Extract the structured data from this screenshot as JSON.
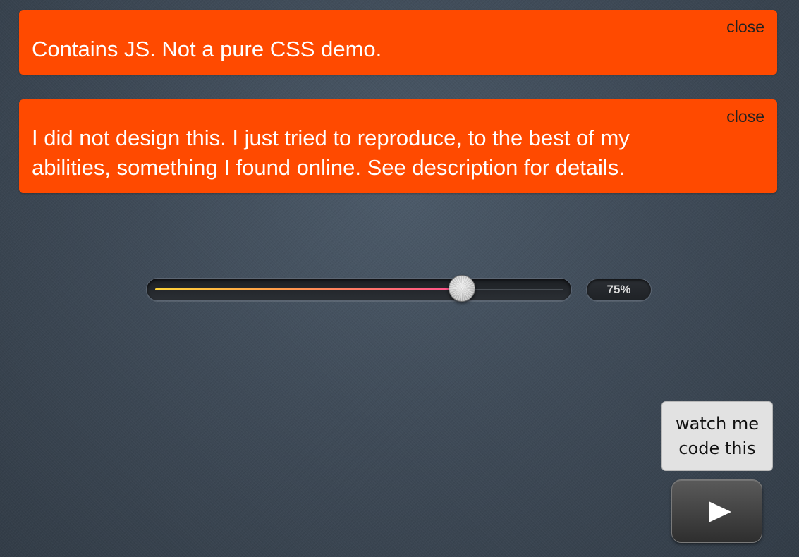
{
  "notices": [
    {
      "text": "Contains JS. Not a pure CSS demo.",
      "close_label": "close"
    },
    {
      "text": "I did not design this. I just tried to reproduce, to the best of my abilities, something I found online. See description for details.",
      "close_label": "close"
    }
  ],
  "slider": {
    "value_percent": 75,
    "value_label": "75%",
    "fill_colors": [
      "#ffd43a",
      "#ff9c4a",
      "#ff4f8f"
    ]
  },
  "watch": {
    "line1": "watch me",
    "line2": "code this"
  },
  "play": {
    "icon": "play-icon"
  },
  "colors": {
    "notice_bg": "#ff4a00",
    "background": "#3f4b58"
  }
}
